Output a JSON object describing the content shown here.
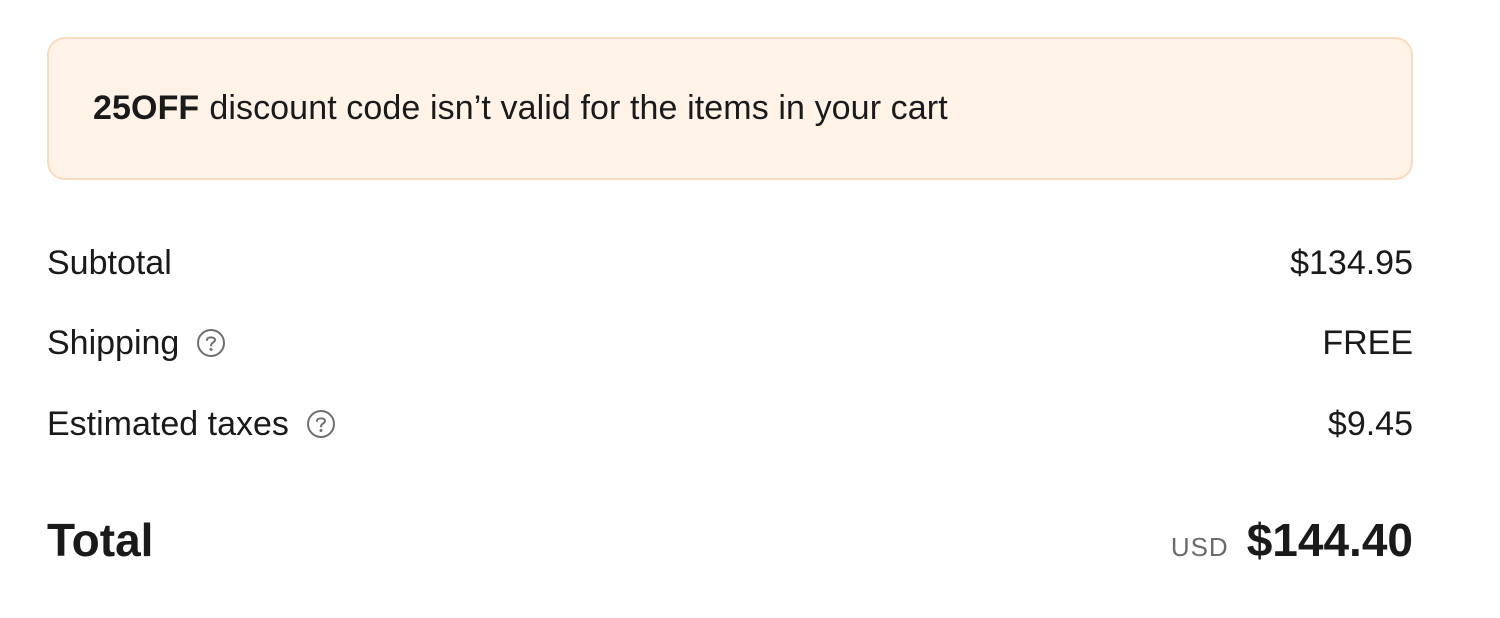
{
  "notice": {
    "code": "25OFF",
    "message": "discount code isn’t valid for the items in your cart",
    "background_color": "#fff3e8",
    "border_color": "#f9dcbf"
  },
  "summary": {
    "subtotal": {
      "label": "Subtotal",
      "value": "$134.95"
    },
    "shipping": {
      "label": "Shipping",
      "value": "FREE",
      "help_icon": "question-circle-icon"
    },
    "taxes": {
      "label": "Estimated taxes",
      "value": "$9.45",
      "help_icon": "question-circle-icon"
    },
    "total": {
      "label": "Total",
      "currency": "USD",
      "value": "$144.40"
    }
  }
}
